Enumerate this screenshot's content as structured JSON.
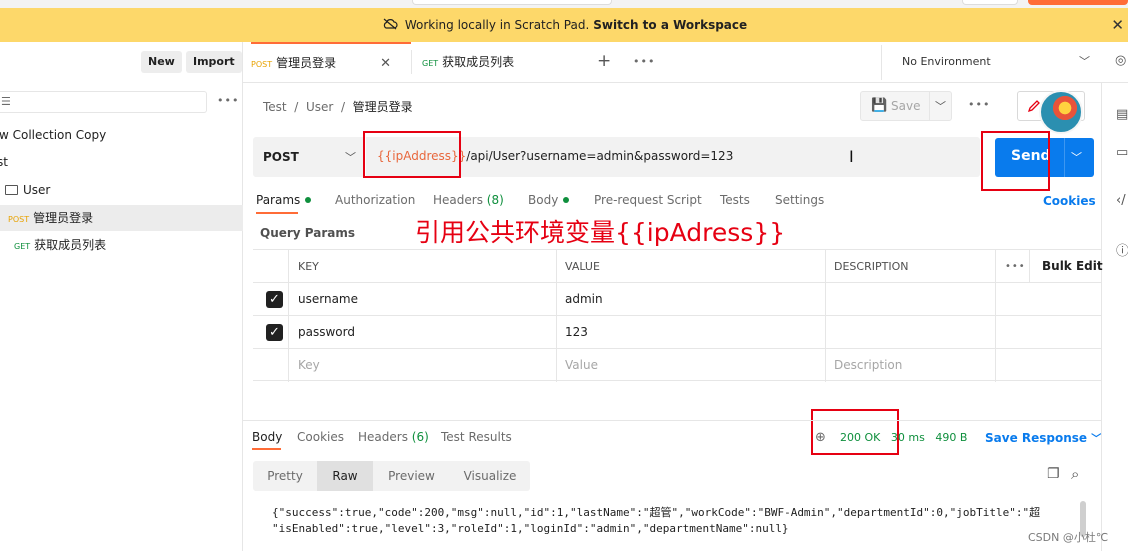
{
  "banner": {
    "text": "Working locally in Scratch Pad.",
    "link": "Switch to a Workspace",
    "icon": "cloud-off-icon"
  },
  "sidebar": {
    "new_label": "New",
    "import_label": "Import",
    "items": [
      {
        "label": "w Collection Copy"
      },
      {
        "label": "st"
      },
      {
        "label": "User"
      },
      {
        "method": "POST",
        "label": "管理员登录"
      },
      {
        "method": "GET",
        "label": "获取成员列表"
      }
    ]
  },
  "tabs": [
    {
      "method": "POST",
      "label": "管理员登录"
    },
    {
      "method": "GET",
      "label": "获取成员列表"
    }
  ],
  "environment": "No Environment",
  "breadcrumb": {
    "parts": [
      "Test",
      "User"
    ],
    "current": "管理员登录"
  },
  "toolbar": {
    "save_label": "Save"
  },
  "request": {
    "method": "POST",
    "url_var": "{{ipAddress}}",
    "url_rest": "/api/User?username=admin&password=123",
    "send_label": "Send"
  },
  "request_tabs": {
    "params": "Params",
    "authorization": "Authorization",
    "headers": "Headers",
    "headers_count": "(8)",
    "body": "Body",
    "pre_request": "Pre-request Script",
    "tests": "Tests",
    "settings": "Settings",
    "cookies": "Cookies"
  },
  "annotation": "引用公共环境变量{{ipAdress}}",
  "query_params": {
    "title": "Query Params",
    "columns": {
      "key": "KEY",
      "value": "VALUE",
      "description": "DESCRIPTION",
      "bulk_edit": "Bulk Edit"
    },
    "rows": [
      {
        "key": "username",
        "value": "admin",
        "checked": true
      },
      {
        "key": "password",
        "value": "123",
        "checked": true
      }
    ],
    "placeholders": {
      "key": "Key",
      "value": "Value",
      "description": "Description"
    }
  },
  "response": {
    "tabs": {
      "body": "Body",
      "cookies": "Cookies",
      "headers": "Headers",
      "headers_count": "(6)",
      "test_results": "Test Results"
    },
    "status": "200 OK",
    "time": "30 ms",
    "size": "490 B",
    "save_label": "Save Response",
    "views": [
      "Pretty",
      "Raw",
      "Preview",
      "Visualize"
    ],
    "active_view": "Raw",
    "body_line1": "{\"success\":true,\"code\":200,\"msg\":null,\"id\":1,\"lastName\":\"超管\",\"workCode\":\"BWF-Admin\",\"departmentId\":0,\"jobTitle\":\"超",
    "body_line2": "\"isEnabled\":true,\"level\":3,\"roleId\":1,\"loginId\":\"admin\",\"departmentName\":null}"
  },
  "watermark": "CSDN @小杜℃",
  "colors": {
    "banner": "#fdd86a",
    "accent": "#ff6c37",
    "send": "#097bed",
    "annotation_red": "#e60012",
    "status_green": "#0f8f3d"
  }
}
